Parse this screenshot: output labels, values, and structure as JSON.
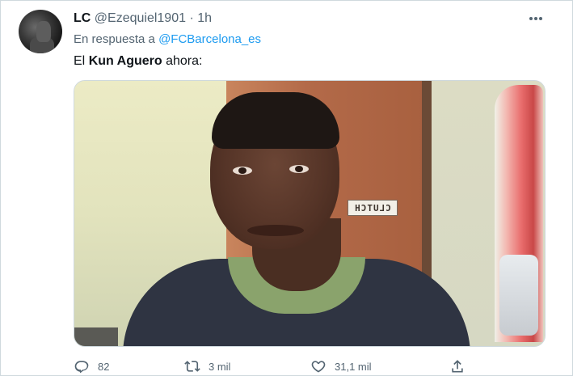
{
  "tweet": {
    "author_name": "LC",
    "author_handle": "@Ezequiel1901",
    "separator": "·",
    "time": "1h",
    "reply_prefix": "En respuesta a",
    "reply_to": "@FCBarcelona_es",
    "text_before": "El",
    "text_bold": "Kun Aguero",
    "text_after": "ahora:",
    "media": {
      "sign_text": "CLUTCH"
    }
  },
  "actions": {
    "replies": "82",
    "retweets": "3 mil",
    "likes": "31,1 mil"
  },
  "icons": {
    "reply": "reply-icon",
    "retweet": "retweet-icon",
    "like": "heart-icon",
    "share": "share-icon",
    "more": "more-icon"
  },
  "colors": {
    "accent": "#1d9bf0",
    "secondary_text": "#536471",
    "primary_text": "#0f1419",
    "border": "#cfd9de"
  }
}
